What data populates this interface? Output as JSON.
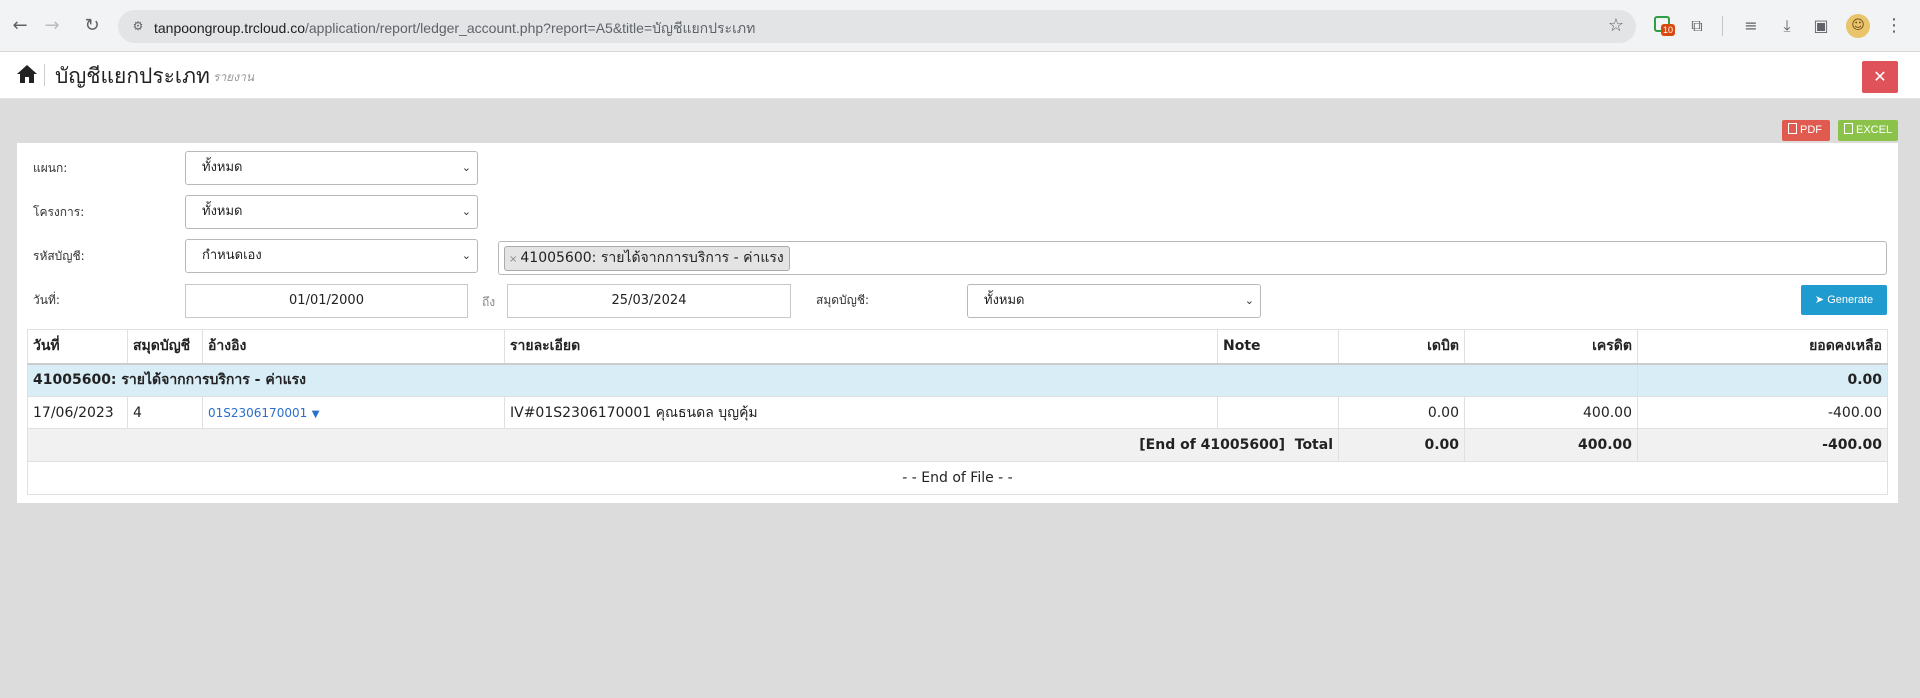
{
  "browser": {
    "url_host": "tanpoongroup.trcloud.co",
    "url_path": "/application/report/ledger_account.php?report=A5&title=บัญชีแยกประเภท",
    "ext_badge": "10"
  },
  "header": {
    "title": "บัญชีแยกประเภท",
    "subtitle": "รายงาน",
    "close_label": "✕"
  },
  "export": {
    "pdf_label": "PDF",
    "excel_label": "EXCEL"
  },
  "filters": {
    "department_label": "แผนก:",
    "department_value": "ทั้งหมด",
    "project_label": "โครงการ:",
    "project_value": "ทั้งหมด",
    "account_label": "รหัสบัญชี:",
    "account_value": "กำหนดเอง",
    "account_tag": "41005600: รายได้จากการบริการ - ค่าแรง",
    "date_label": "วันที่:",
    "date_from": "01/01/2000",
    "to_label": "ถึง",
    "date_to": "25/03/2024",
    "journal_label": "สมุดบัญชี:",
    "journal_value": "ทั้งหมด",
    "generate_label": "Generate"
  },
  "table": {
    "headers": [
      "วันที่",
      "สมุดบัญชี",
      "อ้างอิง",
      "รายละเอียด",
      "Note",
      "เดบิต",
      "เครดิต",
      "ยอดคงเหลือ"
    ],
    "group": {
      "title": "41005600: รายได้จากการบริการ - ค่าแรง",
      "balance": "0.00"
    },
    "rows": [
      {
        "date": "17/06/2023",
        "journal": "4",
        "reference": "01S2306170001",
        "detail": "IV#01S2306170001 คุณธนดล บุญคุ้ม",
        "note": "",
        "debit": "0.00",
        "credit": "400.00",
        "balance": "-400.00"
      }
    ],
    "total": {
      "label": "[End of 41005600]  Total",
      "debit": "0.00",
      "credit": "400.00",
      "balance": "-400.00"
    },
    "eof": "- - End of File - -"
  }
}
